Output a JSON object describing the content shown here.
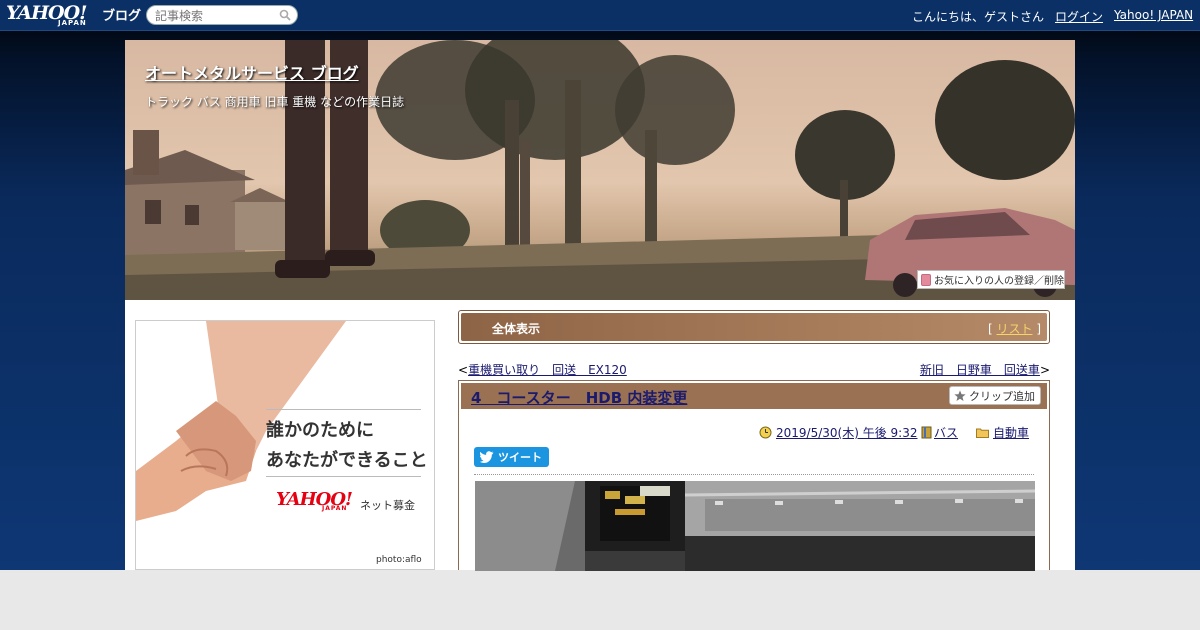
{
  "topbar": {
    "logo_yahoo": "YAHOO!",
    "logo_japan": "JAPAN",
    "logo_blog": "ブログ",
    "search_placeholder": "記事検索",
    "greeting": "こんにちは、ゲストさん",
    "login_label": "ログイン",
    "yahoo_japan_label": "Yahoo! JAPAN"
  },
  "header": {
    "blog_title": "オートメタルサービス ブログ",
    "blog_description": "トラック バス 商用車 旧車 重機 などの作業日誌",
    "favorite_label": "お気に入りの人の登録／削除"
  },
  "ad": {
    "line1": "誰かのために",
    "line2": "あなたができること",
    "logo_yahoo": "YAHOO!",
    "logo_japan": "JAPAN",
    "service": "ネット募金",
    "credit": "photo:aflo"
  },
  "view_bar": {
    "view_all": "全体表示",
    "bracket_open": "[ ",
    "list_label": "リスト",
    "bracket_close": " ]"
  },
  "nav": {
    "prev_label": "重機買い取り　回送　EX120",
    "next_label": "新旧　日野車　回送車"
  },
  "article": {
    "title": "4　コースター　HDB 内装変更",
    "clip_label": "クリップ追加",
    "date": "2019/5/30(木) 午後 9:32",
    "category": "バス",
    "folder": "自動車",
    "tweet_label": "ツイート"
  },
  "colors": {
    "topbar": "#0a3065",
    "accent_brown": "#9a7152",
    "link": "#1a1a6e",
    "tweet": "#1b95e0",
    "yahoo_red": "#e50012"
  }
}
